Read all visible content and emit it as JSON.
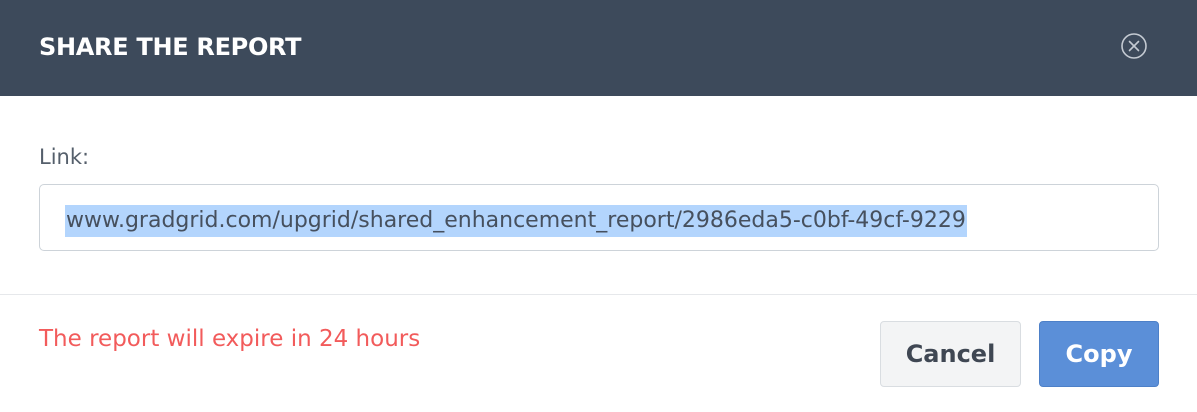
{
  "modal": {
    "title": "SHARE THE REPORT",
    "close_icon": "close-circle-icon"
  },
  "link": {
    "label": "Link:",
    "value": "www.gradgrid.com/upgrid/shared_enhancement_report/2986eda5-c0bf-49cf-9229",
    "selected": true
  },
  "footer": {
    "expire_note": "The report will expire in 24 hours",
    "cancel_label": "Cancel",
    "copy_label": "Copy"
  },
  "colors": {
    "header_bg": "#3d4a5b",
    "primary": "#5b8fd8",
    "warning_text": "#f25b5b",
    "selection": "#b3d5fd"
  }
}
